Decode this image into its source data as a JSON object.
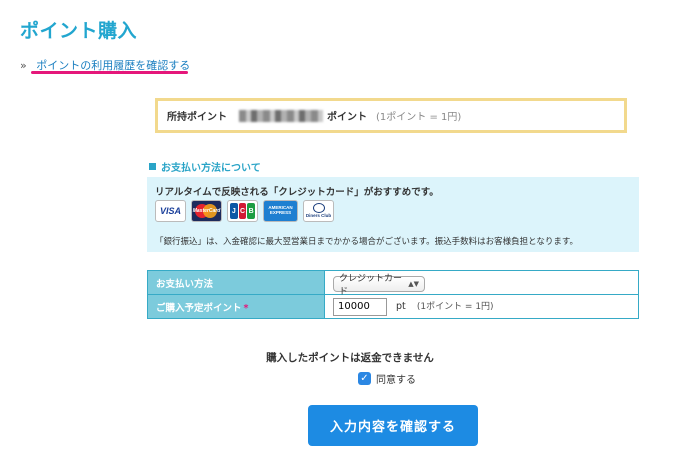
{
  "page": {
    "title": "ポイント購入",
    "history_bullet": "»",
    "history_link": "ポイントの利用履歴を確認する"
  },
  "points": {
    "label": "所持ポイント",
    "unit": "ポイント",
    "rate": "(1ポイント = 1円)"
  },
  "payment_info": {
    "heading": "お支払い方法について",
    "recommend": "リアルタイムで反映される「クレジットカード」がおすすめです。",
    "cards": {
      "visa": "VISA",
      "mastercard": "MasterCard",
      "jcb": [
        "J",
        "C",
        "B"
      ],
      "amex": "AMERICAN EXPRESS",
      "diners": "Diners Club"
    },
    "bank_note": "「銀行振込」は、入金確認に最大翌営業日までかかる場合がございます。振込手数料はお客様負担となります。"
  },
  "form": {
    "payment_method_label": "お支払い方法",
    "payment_method_value": "クレジットカード",
    "points_label": "ご購入予定ポイント",
    "required_mark": "*",
    "points_value": "10000",
    "points_unit": "pt",
    "points_rate": "(1ポイント = 1円)"
  },
  "notice": "購入したポイントは返金できません",
  "agree_label": "同意する",
  "submit_label": "入力内容を確認する",
  "colors": {
    "accent": "#22a6cf",
    "link": "#1b7fc0",
    "highlight": "#e5177a",
    "button": "#1d8be3"
  }
}
